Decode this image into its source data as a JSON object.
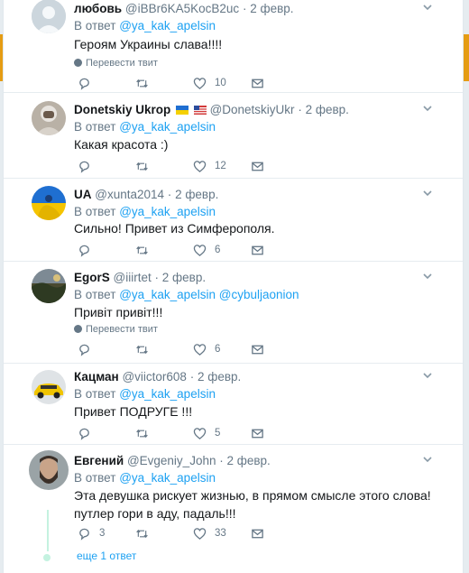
{
  "ui": {
    "reply_prefix": "В ответ",
    "translate_label": "Перевести твит",
    "dot": "·"
  },
  "tweets": [
    {
      "name": "любовь",
      "handle": "@iBBr6KA5KocB2uc",
      "time": "2 февр.",
      "reply_to": [
        "@ya_kak_apelsin"
      ],
      "text": "Героям Украины слава!!!!",
      "translate": true,
      "replies": "",
      "retweets": "",
      "likes": "10"
    },
    {
      "name": "Donetskiy Ukrop",
      "handle": "@DonetskiyUkr",
      "time": "2 февр.",
      "reply_to": [
        "@ya_kak_apelsin"
      ],
      "text": "Какая красота :)",
      "flags": [
        "ukraine-flag-icon",
        "usa-flag-icon"
      ],
      "translate": false,
      "replies": "",
      "retweets": "",
      "likes": "12"
    },
    {
      "name": "UA",
      "handle": "@xunta2014",
      "time": "2 февр.",
      "reply_to": [
        "@ya_kak_apelsin"
      ],
      "text": "Сильно! Привет из Симферополя.",
      "translate": false,
      "replies": "",
      "retweets": "",
      "likes": "6"
    },
    {
      "name": "EgorS",
      "handle": "@iiirtet",
      "time": "2 февр.",
      "reply_to": [
        "@ya_kak_apelsin",
        "@cybuljaonion"
      ],
      "text": "Привіт привіт!!!",
      "translate": true,
      "replies": "",
      "retweets": "",
      "likes": "6"
    },
    {
      "name": "Кацман",
      "handle": "@viictor608",
      "time": "2 февр.",
      "reply_to": [
        "@ya_kak_apelsin"
      ],
      "text": "Привет ПОДРУГЕ !!!",
      "translate": false,
      "replies": "",
      "retweets": "",
      "likes": "5"
    },
    {
      "name": "Евгений",
      "handle": "@Evgeniy_John",
      "time": "2 февр.",
      "reply_to": [
        "@ya_kak_apelsin"
      ],
      "text": "Эта девушка рискует жизнью, в прямом смысле этого слова! путлер гори в аду, падаль!!!",
      "translate": false,
      "replies": "3",
      "retweets": "",
      "likes": "33"
    }
  ],
  "thread": {
    "more_replies": "еще 1 ответ"
  },
  "colors": {
    "accent": "#1da1f2",
    "muted": "#657786",
    "border": "#e6ecf0",
    "thread_line": "#c4f2e0"
  }
}
